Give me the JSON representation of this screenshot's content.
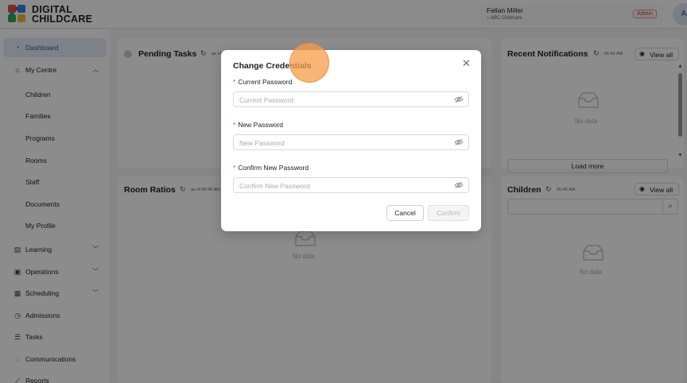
{
  "brand": {
    "line1": "DIGITAL",
    "line2": "CHILDCARE"
  },
  "user": {
    "name": "Fellan Miller",
    "center": "ABC Childcare",
    "role": "Admin",
    "avatar_initial": "A"
  },
  "sidebar": {
    "items": [
      {
        "label": "Dashboard",
        "icon": "dashboard-icon",
        "active": true
      },
      {
        "label": "My Centre",
        "icon": "home-icon",
        "expanded": true
      },
      {
        "label": "Learning",
        "icon": "book-icon"
      },
      {
        "label": "Operations",
        "icon": "operations-icon"
      },
      {
        "label": "Scheduling",
        "icon": "calendar-icon"
      },
      {
        "label": "Admissions",
        "icon": "admissions-icon"
      },
      {
        "label": "Tasks",
        "icon": "tasks-icon"
      },
      {
        "label": "Communications",
        "icon": "chat-icon"
      },
      {
        "label": "Reports",
        "icon": "reports-icon"
      }
    ],
    "my_centre_sub": [
      "Children",
      "Families",
      "Programs",
      "Rooms",
      "Staff",
      "Documents",
      "My Profile"
    ]
  },
  "panels": {
    "pending_tasks": {
      "title": "Pending Tasks",
      "as_of": "as of"
    },
    "room_ratios": {
      "title": "Room Ratios",
      "as_of": "as of 06:46 AM",
      "empty": "No data"
    },
    "recent_notifications": {
      "title": "Recent Notifications",
      "time": "06:46 AM",
      "view_all": "View all",
      "empty": "No data",
      "load_more": "Load more"
    },
    "children": {
      "title": "Children",
      "time": "06:46 AM",
      "view_all": "View all",
      "empty": "No data"
    }
  },
  "modal": {
    "title": "Change Credentials",
    "close_icon": "close-icon",
    "fields": [
      {
        "label": "Current Password",
        "placeholder": "Current Password",
        "value": ""
      },
      {
        "label": "New Password",
        "placeholder": "New Password",
        "value": ""
      },
      {
        "label": "Confirm New Password",
        "placeholder": "Confirm New Password",
        "value": ""
      }
    ],
    "cancel_label": "Cancel",
    "confirm_label": "Confirm"
  },
  "colors": {
    "accent": "#2f5ea8",
    "required": "#e04a3b",
    "admin_badge": "#c0392b",
    "click_marker": "#f79c48"
  }
}
